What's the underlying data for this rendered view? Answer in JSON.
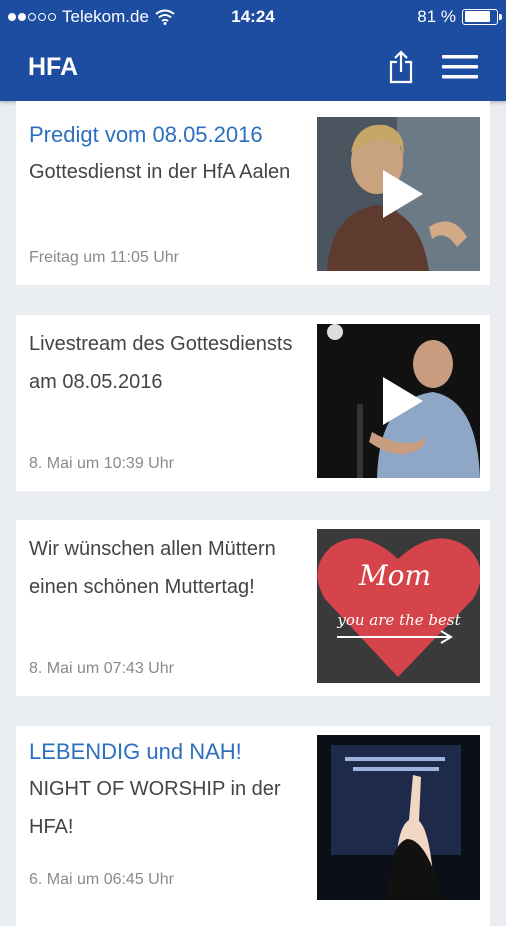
{
  "status_bar": {
    "carrier": "Telekom.de",
    "time": "14:24",
    "battery": "81 %",
    "battery_level": 0.81
  },
  "app_bar": {
    "title": "HFA",
    "share_icon": "share-icon",
    "menu_icon": "hamburger-menu-icon"
  },
  "posts": [
    {
      "headline": "Predigt vom 08.05.2016",
      "body": "Gottesdienst in der HfA Aalen",
      "time": "Freitag um 11:05 Uhr",
      "thumb": "video",
      "has_play": true
    },
    {
      "headline": "",
      "body": "Livestream des Gottesdiensts am 08.05.2016",
      "time": "8. Mai um 10:39 Uhr",
      "thumb": "video",
      "has_play": true
    },
    {
      "headline": "",
      "body": "Wir wünschen allen Müttern einen schönen Muttertag!",
      "time": "8. Mai um 07:43 Uhr",
      "thumb": "heart",
      "thumb_text_1": "Mom",
      "thumb_text_2": "you are the best",
      "has_play": false
    },
    {
      "headline": "LEBENDIG und NAH!",
      "body": "NIGHT OF WORSHIP in der HFA!",
      "time": "6. Mai um 06:45 Uhr",
      "thumb": "worship",
      "has_play": false
    }
  ]
}
